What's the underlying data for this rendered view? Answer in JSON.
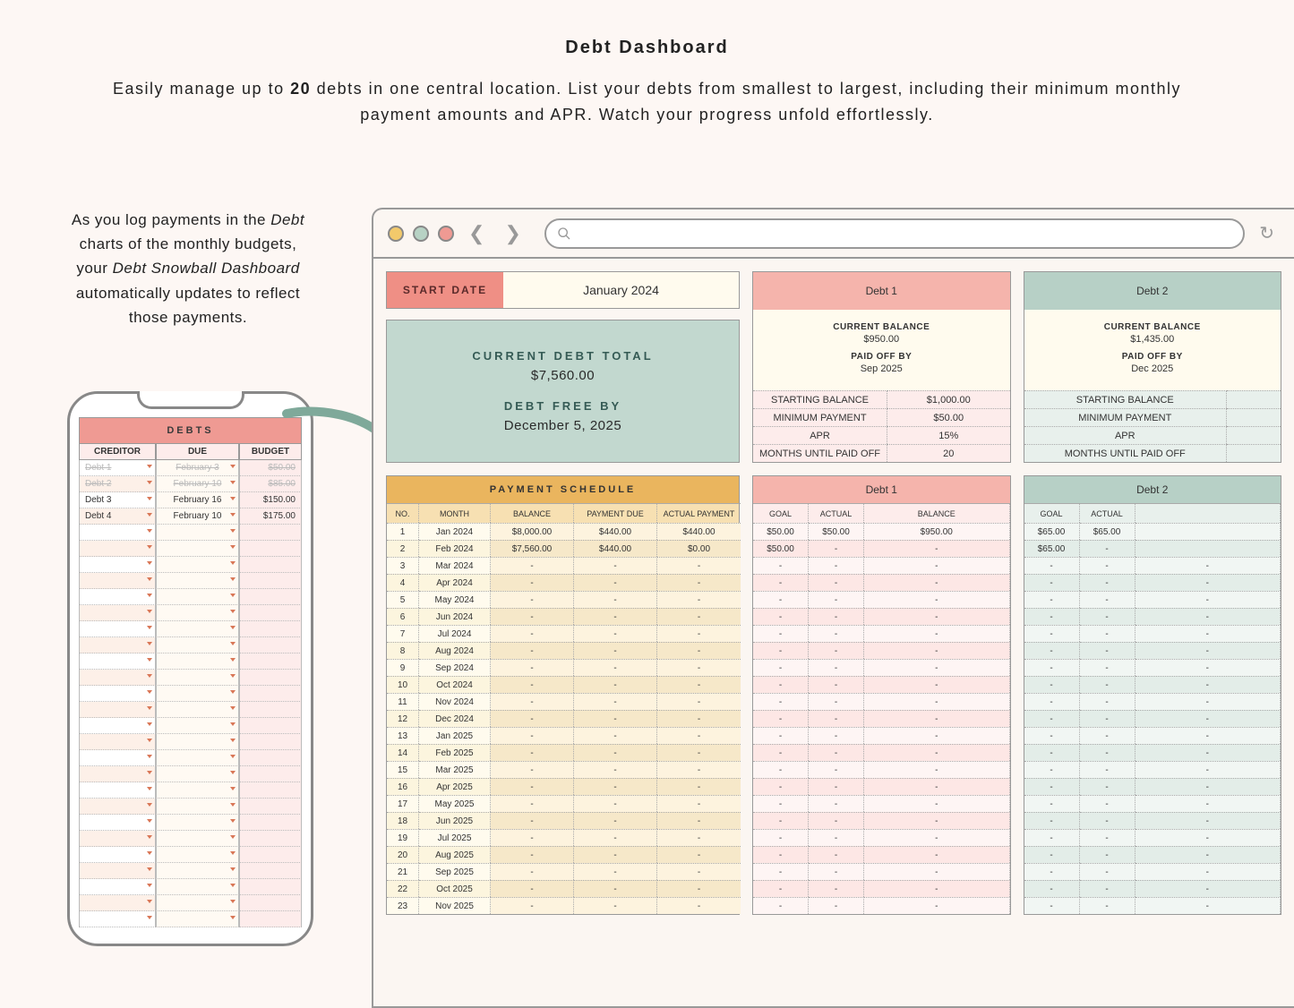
{
  "page": {
    "title": "Debt Dashboard",
    "subtitle_pre": "Easily manage up to ",
    "subtitle_bold": "20",
    "subtitle_post": " debts in one central location. List your debts from smallest to largest, including their minimum monthly payment amounts and APR. Watch your progress unfold effortlessly."
  },
  "caption": {
    "l1a": "As you log payments in the ",
    "l2a": "Debt",
    "l2b": " charts of the monthly budgets, your ",
    "l3a": "Debt Snowball Dashboard",
    "l3b": " automatically updates to reflect those payments."
  },
  "phone": {
    "title": "DEBTS",
    "cols": {
      "creditor": "CREDITOR",
      "due": "DUE",
      "budget": "BUDGET"
    },
    "rows": [
      {
        "creditor": "Debt 1",
        "due": "February 3",
        "budget": "$50.00",
        "done": true
      },
      {
        "creditor": "Debt 2",
        "due": "February 10",
        "budget": "$85.00",
        "done": true
      },
      {
        "creditor": "Debt 3",
        "due": "February 16",
        "budget": "$150.00",
        "done": false
      },
      {
        "creditor": "Debt 4",
        "due": "February 10",
        "budget": "$175.00",
        "done": false
      }
    ],
    "empty_rows": 25
  },
  "browser": {
    "start_label": "START DATE",
    "start_value": "January 2024",
    "summary": {
      "total_label": "CURRENT DEBT TOTAL",
      "total_value": "$7,560.00",
      "free_label": "DEBT FREE BY",
      "free_value": "December 5, 2025"
    },
    "debt1": {
      "name": "Debt 1",
      "cb_label": "CURRENT BALANCE",
      "cb_value": "$950.00",
      "po_label": "PAID OFF BY",
      "po_value": "Sep 2025",
      "rows": [
        {
          "k": "STARTING BALANCE",
          "v": "$1,000.00"
        },
        {
          "k": "MINIMUM PAYMENT",
          "v": "$50.00"
        },
        {
          "k": "APR",
          "v": "15%"
        },
        {
          "k": "MONTHS UNTIL PAID OFF",
          "v": "20"
        }
      ]
    },
    "debt2": {
      "name": "Debt 2",
      "cb_label": "CURRENT BALANCE",
      "cb_value": "$1,435.00",
      "po_label": "PAID OFF BY",
      "po_value": "Dec 2025",
      "rows": [
        {
          "k": "STARTING BALANCE",
          "v": ""
        },
        {
          "k": "MINIMUM PAYMENT",
          "v": ""
        },
        {
          "k": "APR",
          "v": ""
        },
        {
          "k": "MONTHS UNTIL PAID OFF",
          "v": ""
        }
      ]
    },
    "schedule": {
      "title": "PAYMENT SCHEDULE",
      "cols": {
        "no": "NO.",
        "month": "MONTH",
        "balance": "BALANCE",
        "due": "PAYMENT DUE",
        "actual": "ACTUAL PAYMENT"
      },
      "rows": [
        {
          "no": "1",
          "month": "Jan 2024",
          "balance": "$8,000.00",
          "due": "$440.00",
          "actual": "$440.00"
        },
        {
          "no": "2",
          "month": "Feb 2024",
          "balance": "$7,560.00",
          "due": "$440.00",
          "actual": "$0.00"
        },
        {
          "no": "3",
          "month": "Mar 2024",
          "balance": "-",
          "due": "-",
          "actual": "-"
        },
        {
          "no": "4",
          "month": "Apr 2024",
          "balance": "-",
          "due": "-",
          "actual": "-"
        },
        {
          "no": "5",
          "month": "May 2024",
          "balance": "-",
          "due": "-",
          "actual": "-"
        },
        {
          "no": "6",
          "month": "Jun 2024",
          "balance": "-",
          "due": "-",
          "actual": "-"
        },
        {
          "no": "7",
          "month": "Jul 2024",
          "balance": "-",
          "due": "-",
          "actual": "-"
        },
        {
          "no": "8",
          "month": "Aug 2024",
          "balance": "-",
          "due": "-",
          "actual": "-"
        },
        {
          "no": "9",
          "month": "Sep 2024",
          "balance": "-",
          "due": "-",
          "actual": "-"
        },
        {
          "no": "10",
          "month": "Oct 2024",
          "balance": "-",
          "due": "-",
          "actual": "-"
        },
        {
          "no": "11",
          "month": "Nov 2024",
          "balance": "-",
          "due": "-",
          "actual": "-"
        },
        {
          "no": "12",
          "month": "Dec 2024",
          "balance": "-",
          "due": "-",
          "actual": "-"
        },
        {
          "no": "13",
          "month": "Jan 2025",
          "balance": "-",
          "due": "-",
          "actual": "-"
        },
        {
          "no": "14",
          "month": "Feb 2025",
          "balance": "-",
          "due": "-",
          "actual": "-"
        },
        {
          "no": "15",
          "month": "Mar 2025",
          "balance": "-",
          "due": "-",
          "actual": "-"
        },
        {
          "no": "16",
          "month": "Apr 2025",
          "balance": "-",
          "due": "-",
          "actual": "-"
        },
        {
          "no": "17",
          "month": "May 2025",
          "balance": "-",
          "due": "-",
          "actual": "-"
        },
        {
          "no": "18",
          "month": "Jun 2025",
          "balance": "-",
          "due": "-",
          "actual": "-"
        },
        {
          "no": "19",
          "month": "Jul 2025",
          "balance": "-",
          "due": "-",
          "actual": "-"
        },
        {
          "no": "20",
          "month": "Aug 2025",
          "balance": "-",
          "due": "-",
          "actual": "-"
        },
        {
          "no": "21",
          "month": "Sep 2025",
          "balance": "-",
          "due": "-",
          "actual": "-"
        },
        {
          "no": "22",
          "month": "Oct 2025",
          "balance": "-",
          "due": "-",
          "actual": "-"
        },
        {
          "no": "23",
          "month": "Nov 2025",
          "balance": "-",
          "due": "-",
          "actual": "-"
        }
      ]
    },
    "mini1": {
      "name": "Debt 1",
      "cols": {
        "goal": "GOAL",
        "actual": "ACTUAL",
        "balance": "BALANCE"
      },
      "rows": [
        {
          "goal": "$50.00",
          "actual": "$50.00",
          "balance": "$950.00"
        },
        {
          "goal": "$50.00",
          "actual": "-",
          "balance": "-"
        }
      ],
      "empty_rows": 21
    },
    "mini2": {
      "name": "Debt 2",
      "cols": {
        "goal": "GOAL",
        "actual": "ACTUAL",
        "balance": ""
      },
      "rows": [
        {
          "goal": "$65.00",
          "actual": "$65.00",
          "balance": ""
        },
        {
          "goal": "$65.00",
          "actual": "-",
          "balance": ""
        }
      ],
      "empty_rows": 21
    }
  }
}
